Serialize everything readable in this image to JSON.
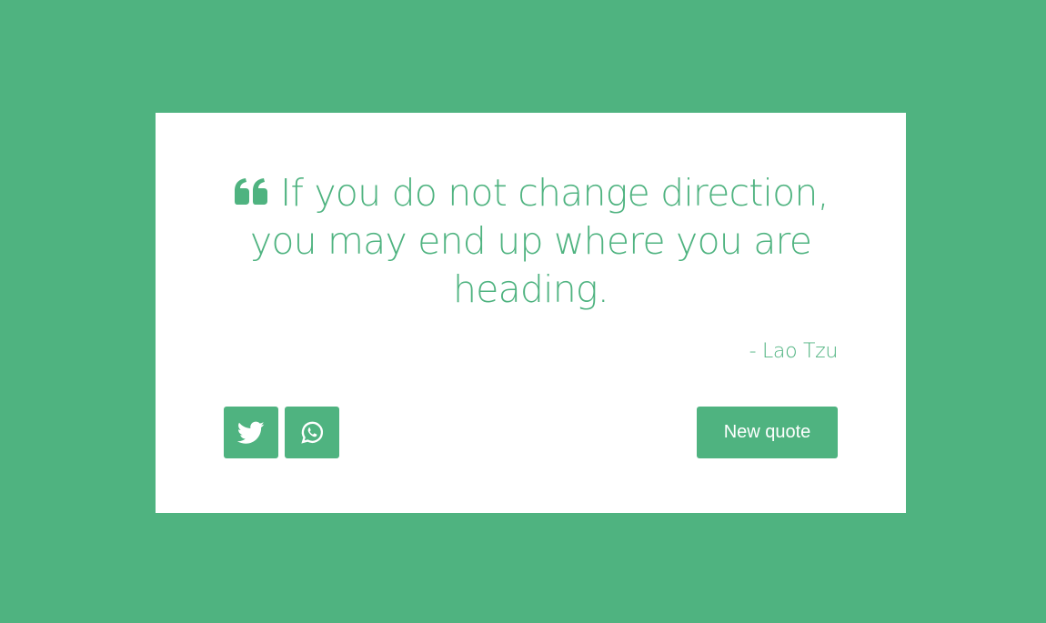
{
  "quote": {
    "text": "If you do not change direction, you may end up where you are heading.",
    "author": "- Lao Tzu"
  },
  "buttons": {
    "new_quote_label": "New quote",
    "twitter_icon": "twitter-bird-icon",
    "whatsapp_icon": "whatsapp-icon"
  },
  "colors": {
    "accent": "#4fb380",
    "card": "#ffffff"
  }
}
